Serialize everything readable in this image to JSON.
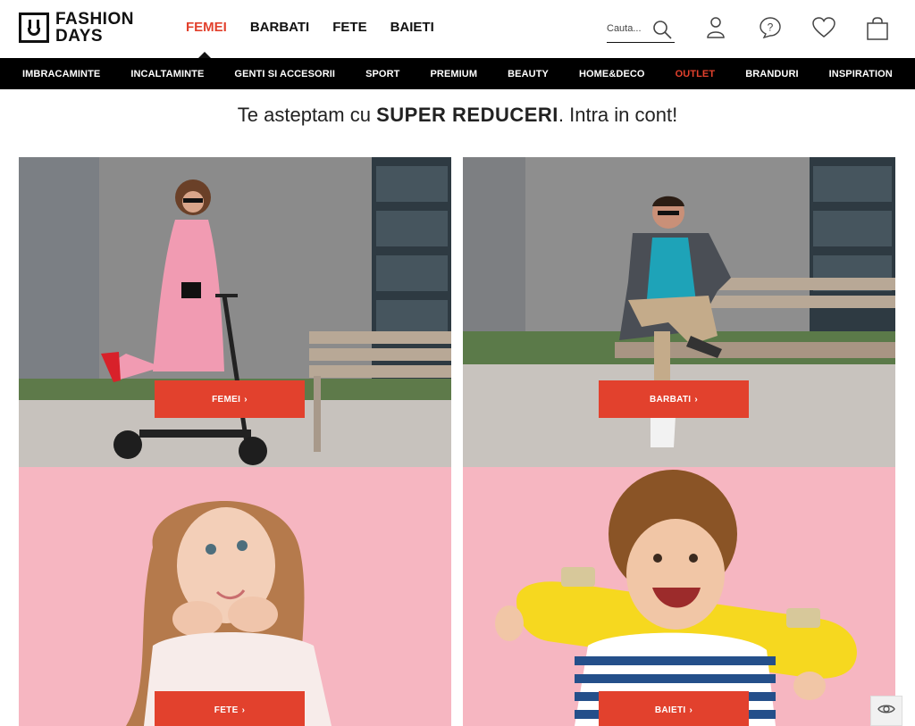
{
  "brand": {
    "line1": "FASHION",
    "line2": "DAYS"
  },
  "gender_nav": [
    {
      "label": "FEMEI",
      "active": true
    },
    {
      "label": "BARBATI",
      "active": false
    },
    {
      "label": "FETE",
      "active": false
    },
    {
      "label": "BAIETI",
      "active": false
    }
  ],
  "search": {
    "placeholder": "Cauta..."
  },
  "header_icons": [
    "account-icon",
    "help-icon",
    "wishlist-heart-icon",
    "shopping-bag-icon"
  ],
  "categories": [
    {
      "label": "IMBRACAMINTE"
    },
    {
      "label": "INCALTAMINTE"
    },
    {
      "label": "GENTI SI ACCESORII"
    },
    {
      "label": "SPORT"
    },
    {
      "label": "PREMIUM"
    },
    {
      "label": "BEAUTY"
    },
    {
      "label": "HOME&DECO"
    },
    {
      "label": "OUTLET",
      "highlight": true
    },
    {
      "label": "BRANDURI"
    },
    {
      "label": "INSPIRATION"
    }
  ],
  "promo": {
    "prefix": "Te asteptam cu",
    "bold": "SUPER REDUCERI",
    "suffix": ". Intra in cont!"
  },
  "tiles": [
    {
      "id": "femei",
      "button_label": "FEMEI",
      "chevron": "›"
    },
    {
      "id": "barbati",
      "button_label": "BARBATI",
      "chevron": "›"
    },
    {
      "id": "fete",
      "button_label": "FETE",
      "chevron": "›"
    },
    {
      "id": "baieti",
      "button_label": "BAIETI",
      "chevron": "›"
    }
  ],
  "colors": {
    "accent": "#e2412d",
    "category_bar": "#000000",
    "tile_pink": "#f6b6c1"
  }
}
